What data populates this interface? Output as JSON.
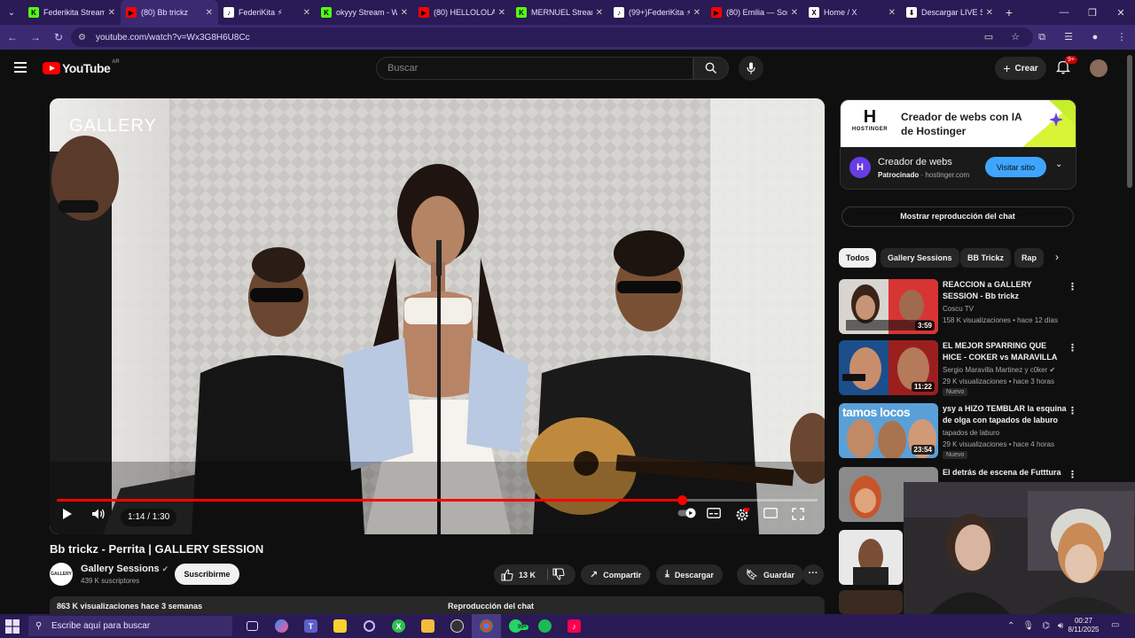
{
  "browser": {
    "tabs": [
      {
        "title": "Federikita Stream",
        "fav": "K",
        "favColor": "#53fc18",
        "active": false
      },
      {
        "title": "(80) Bb trickz",
        "fav": "▶",
        "favColor": "#ff0000",
        "active": true
      },
      {
        "title": "FederiKita ⚡ ",
        "fav": "♪",
        "favColor": "#ffffff",
        "active": false
      },
      {
        "title": "okyyy Stream - W",
        "fav": "K",
        "favColor": "#53fc18",
        "active": false
      },
      {
        "title": "(80) HELLOLOLA",
        "fav": "▶",
        "favColor": "#ff0000",
        "active": false
      },
      {
        "title": "MERNUEL Stream",
        "fav": "K",
        "favColor": "#53fc18",
        "active": false
      },
      {
        "title": "(99+)FederiKita ⚡",
        "fav": "♪",
        "favColor": "#ffffff",
        "active": false
      },
      {
        "title": "(80) Emilia — Sor",
        "fav": "▶",
        "favColor": "#ff0000",
        "active": false
      },
      {
        "title": "Home / X",
        "fav": "X",
        "favColor": "#ffffff",
        "active": false
      },
      {
        "title": "Descargar LIVE St",
        "fav": "⬇",
        "favColor": "#ffffff",
        "active": false
      }
    ],
    "url": "youtube.com/watch?v=Wx3G8H6U8Cc"
  },
  "youtube": {
    "logo_text": "YouTube",
    "country": "AR",
    "search_placeholder": "Buscar",
    "create_label": "Crear",
    "notif_count": "9+"
  },
  "player": {
    "watermark": "GALLERY",
    "time": "1:14 / 1:30",
    "progress": 0.8222,
    "buffered": 1.0
  },
  "video": {
    "title": "Bb trickz - Perrita | GALLERY SESSION",
    "channel": "Gallery Sessions",
    "channel_avatar": "GALLERY",
    "subscribers": "439 K suscriptores",
    "subscribe_label": "Suscribirme",
    "likes": "13 K",
    "share_label": "Compartir",
    "download_label": "Descargar",
    "save_label": "Guardar",
    "views_line": "863 K visualizaciones  hace 3 semanas",
    "chat_replay_label": "Reproducción del chat"
  },
  "sidebar": {
    "ad": {
      "banner_text": "Creador de webs con IA de Hostinger",
      "brand": "HOSTINGER",
      "title": "Creador de webs",
      "sponsored": "Patrocinado",
      "domain": "hostinger.com",
      "cta": "Visitar sitio"
    },
    "show_chat_label": "Mostrar reproducción del chat",
    "chips": [
      "Todos",
      "Gallery Sessions",
      "BB Trickz",
      "Rap"
    ],
    "recommendations": [
      {
        "title": "REACCION a GALLERY SESSION - Bb trickz",
        "channel": "Coscu TV",
        "meta": "158 K visualizaciones • hace 12 días",
        "duration": "3:59",
        "isNew": false
      },
      {
        "title": "EL MEJOR SPARRING QUE HICE - COKER vs MARAVILLA",
        "channel": "Sergio Maravilla Martinez y c0ker",
        "meta": "29 K visualizaciones • hace 3 horas",
        "duration": "11:22",
        "isNew": true,
        "new_label": "Nuevo"
      },
      {
        "title": "ysy a HIZO TEMBLAR la esquina de olga con tapados de laburo",
        "channel": "tapados de laburo",
        "meta": "29 K visualizaciones • hace 4 horas",
        "duration": "23:54",
        "isNew": true,
        "new_label": "Nuevo",
        "thumb_text": "tamos locos"
      },
      {
        "title": "El detrás de escena de Futttura ft. Tiki",
        "channel": "",
        "meta": "",
        "duration": "",
        "isNew": false
      }
    ]
  },
  "taskbar": {
    "search_placeholder": "Escribe aquí para buscar",
    "time": "00:27",
    "date": "8/11/2025",
    "badge": "99+"
  }
}
